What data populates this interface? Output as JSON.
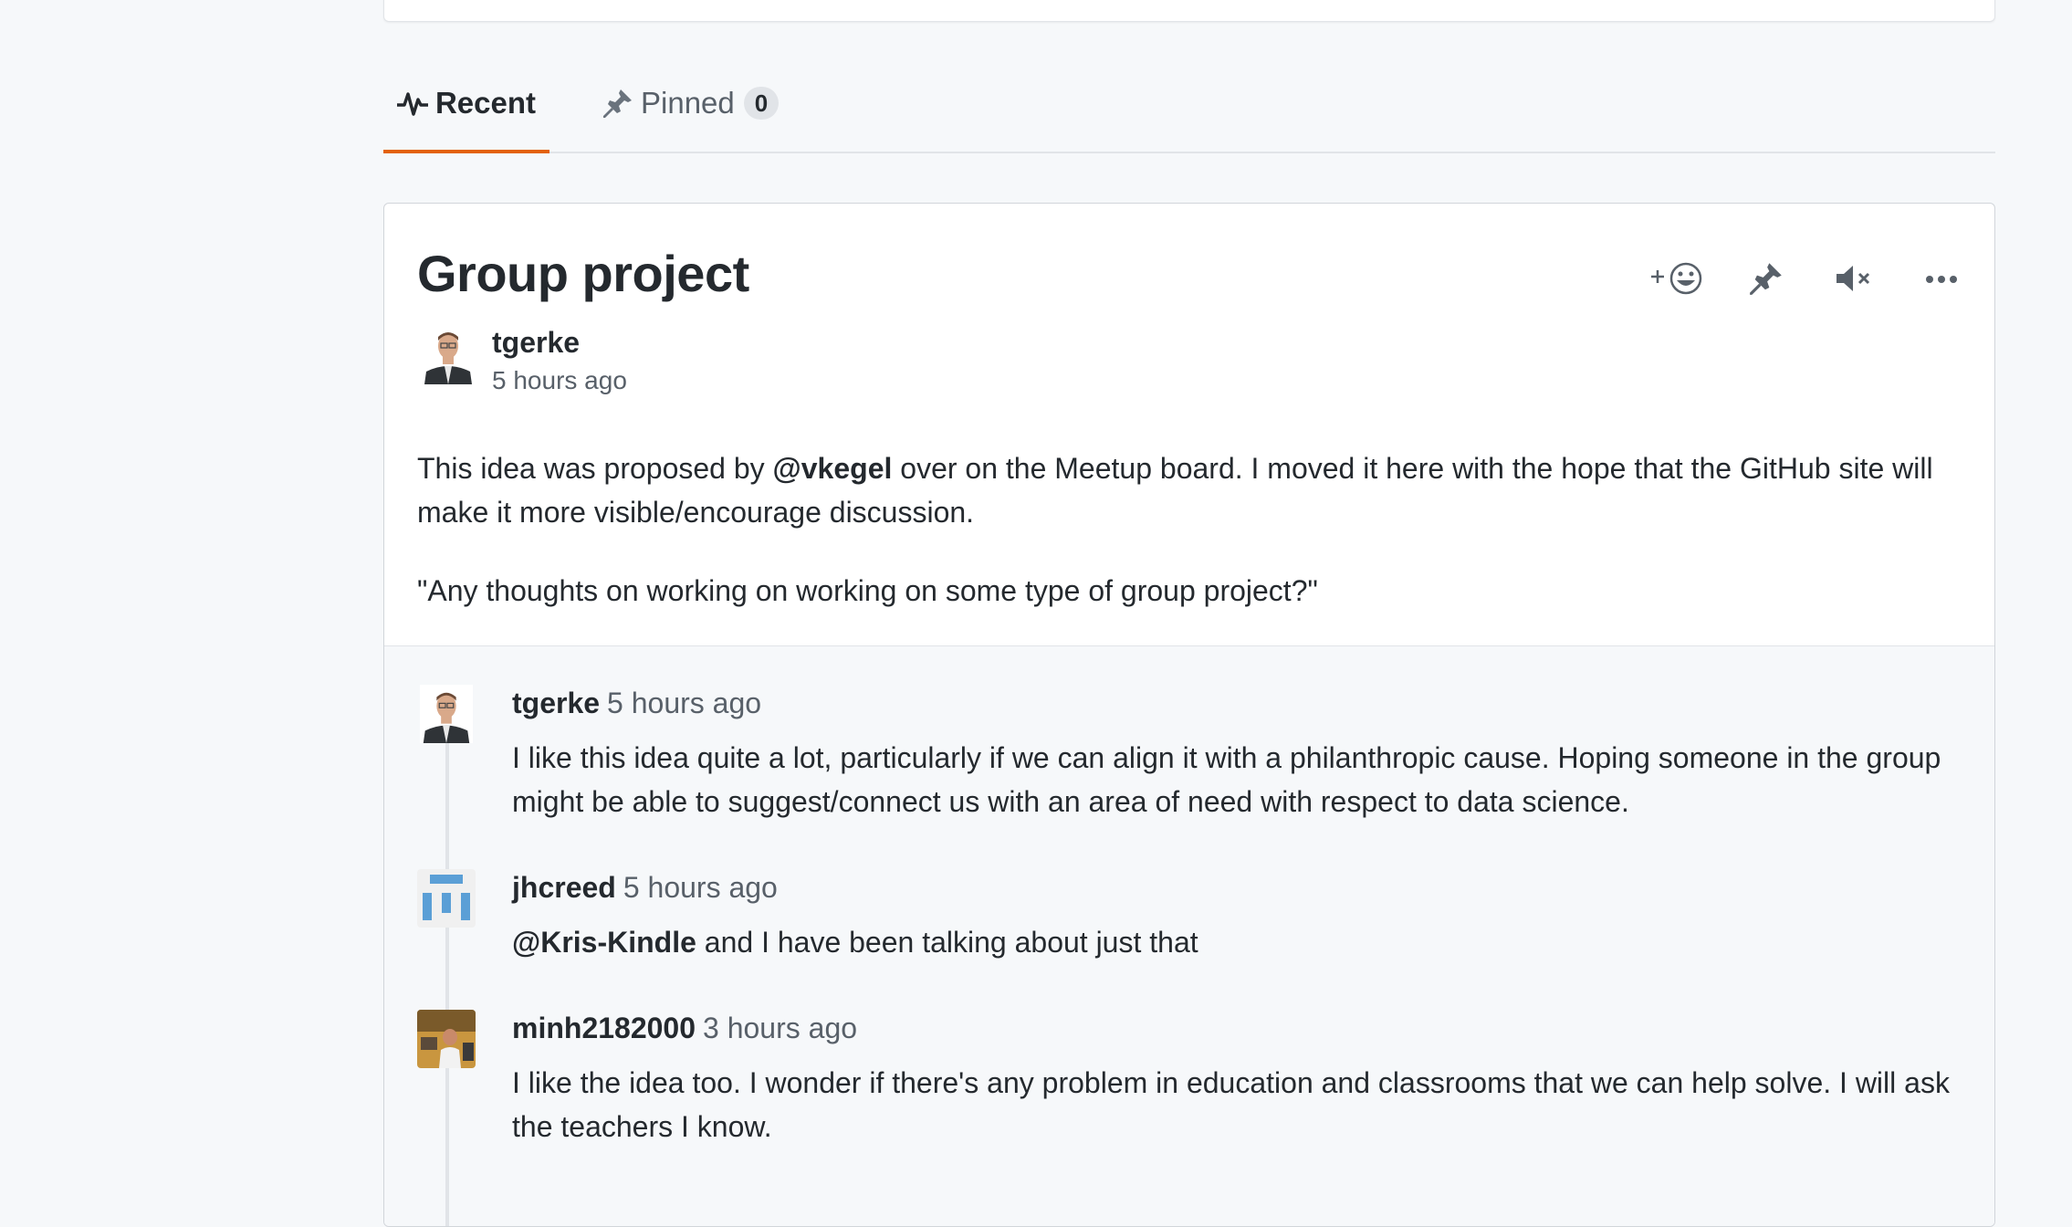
{
  "tabs": {
    "recent_label": "Recent",
    "pinned_label": "Pinned",
    "pinned_count": "0"
  },
  "post": {
    "title": "Group project",
    "author": "tgerke",
    "time": "5 hours ago",
    "body_p1_before": "This idea was proposed by ",
    "body_p1_mention": "@vkegel",
    "body_p1_after": " over on the Meetup board. I moved it here with the hope that the GitHub site will make it more visible/encourage discussion.",
    "body_p2": "\"Any thoughts on working on working on some type of group project?\"",
    "actions": [
      {
        "icon": "add-reaction-icon"
      },
      {
        "icon": "pin-icon"
      },
      {
        "icon": "mute-icon"
      },
      {
        "icon": "more-icon"
      }
    ]
  },
  "comments": [
    {
      "author": "tgerke",
      "time": "5 hours ago",
      "body": "I like this idea quite a lot, particularly if we can align it with a philanthropic cause. Hoping someone in the group might be able to suggest/connect us with an area of need with respect to data science."
    },
    {
      "author": "jhcreed",
      "time": "5 hours ago",
      "mention": "@Kris-Kindle",
      "body": " and I have been talking about just that"
    },
    {
      "author": "minh2182000",
      "time": "3 hours ago",
      "body": "I like the idea too. I wonder if there's any problem in education and classrooms that we can help solve. I will ask the teachers I know."
    }
  ],
  "colors": {
    "accent": "#e36209",
    "text": "#24292e",
    "muted": "#586069",
    "border": "#e1e4e8",
    "identicon": "#5b9fd6"
  }
}
